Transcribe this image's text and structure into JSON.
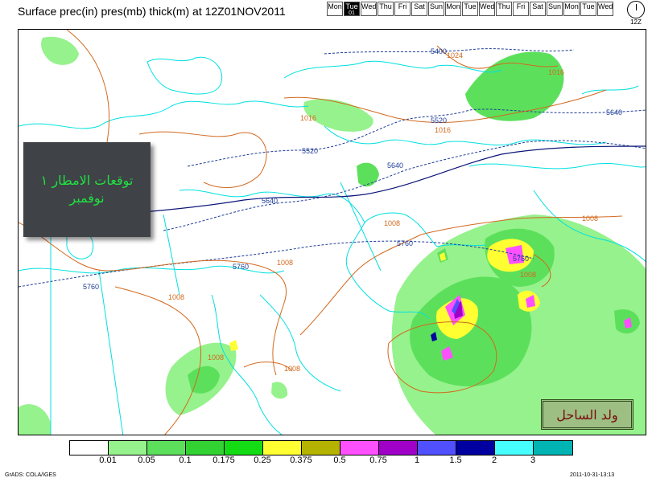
{
  "title": "Surface prec(in) pres(mb) thick(m) at 12Z01NOV2011",
  "days": [
    {
      "label": "Mon",
      "active": false,
      "sub": ""
    },
    {
      "label": "Tue",
      "active": true,
      "sub": "01"
    },
    {
      "label": "Wed",
      "active": false,
      "sub": ""
    },
    {
      "label": "Thu",
      "active": false,
      "sub": ""
    },
    {
      "label": "Fri",
      "active": false,
      "sub": ""
    },
    {
      "label": "Sat",
      "active": false,
      "sub": ""
    },
    {
      "label": "Sun",
      "active": false,
      "sub": ""
    },
    {
      "label": "Mon",
      "active": false,
      "sub": ""
    },
    {
      "label": "Tue",
      "active": false,
      "sub": ""
    },
    {
      "label": "Wed",
      "active": false,
      "sub": ""
    },
    {
      "label": "Thu",
      "active": false,
      "sub": ""
    },
    {
      "label": "Fri",
      "active": false,
      "sub": ""
    },
    {
      "label": "Sat",
      "active": false,
      "sub": ""
    },
    {
      "label": "Sun",
      "active": false,
      "sub": ""
    },
    {
      "label": "Mon",
      "active": false,
      "sub": ""
    },
    {
      "label": "Tue",
      "active": false,
      "sub": ""
    },
    {
      "label": "Wed",
      "active": false,
      "sub": ""
    }
  ],
  "clock_label": "12Z",
  "overlay": {
    "line1": "توقعات الامطار ١",
    "line2": "نوفمبر"
  },
  "signature": "ولد الساحل",
  "legend": {
    "colors": [
      "#ffffff",
      "#96f28c",
      "#5ce05c",
      "#32d232",
      "#14dc14",
      "#ffff32",
      "#b4b400",
      "#ff50ff",
      "#a000c8",
      "#5050ff",
      "#0000a0",
      "#46ffff",
      "#00b4b4"
    ],
    "labels": [
      "0.01",
      "0.05",
      "0.1",
      "0.175",
      "0.25",
      "0.375",
      "0.5",
      "0.75",
      "1",
      "1.5",
      "2",
      "3"
    ]
  },
  "contour_labels": {
    "pressure": [
      "1024",
      "1016",
      "1016",
      "1016",
      "1008",
      "1008",
      "1008",
      "1008",
      "1008",
      "1008",
      "1008"
    ],
    "thickness": [
      "5400",
      "5520",
      "5520",
      "5640",
      "5640",
      "5640",
      "5760",
      "5760",
      "5760",
      "5760"
    ]
  },
  "colors": {
    "coast": "#00e0e0",
    "pressure": "#d2691e",
    "thickness": "#1e3c96",
    "thickness_bold": "#0a1478"
  },
  "footer": {
    "left": "GrADS: COLA/IGES",
    "right": "2011-10-31-13:13"
  }
}
